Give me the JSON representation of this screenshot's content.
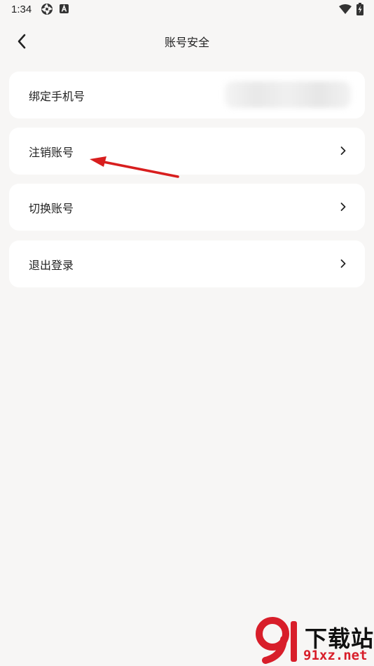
{
  "status_bar": {
    "time": "1:34",
    "icons": [
      "camera-shutter-icon",
      "a-badge-icon",
      "wifi-icon",
      "battery-charging-icon"
    ]
  },
  "header": {
    "title": "账号安全",
    "back_icon": "back-chevron-icon"
  },
  "menu": {
    "items": [
      {
        "label": "绑定手机号",
        "value_blurred": true
      },
      {
        "label": "注销账号",
        "chevron": "chevron-right-icon"
      },
      {
        "label": "切换账号",
        "chevron": "chevron-right-icon"
      },
      {
        "label": "退出登录",
        "chevron": "chevron-right-icon"
      }
    ]
  },
  "annotation": {
    "type": "red-arrow",
    "color": "#d81e1e"
  },
  "watermark": {
    "title": "下载站",
    "domain": "91xz.net",
    "brand_color": "#d81e2a"
  },
  "colors": {
    "background": "#f7f6f5",
    "card": "#ffffff",
    "text": "#222222"
  }
}
